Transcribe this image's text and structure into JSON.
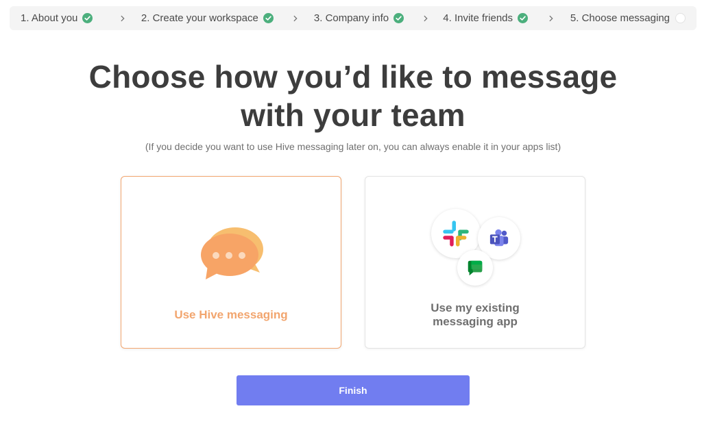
{
  "stepper": {
    "steps": [
      {
        "label": "1. About you",
        "status": "done"
      },
      {
        "label": "2. Create your workspace",
        "status": "done"
      },
      {
        "label": "3. Company info",
        "status": "done"
      },
      {
        "label": "4. Invite friends",
        "status": "done"
      },
      {
        "label": "5. Choose messaging",
        "status": "pending"
      }
    ]
  },
  "heading": {
    "line1": "Choose how you’d like to message",
    "line2": "with your team",
    "subtitle": "(If you decide you want to use Hive messaging later on, you can always enable it in your apps list)"
  },
  "options": {
    "hive": {
      "label": "Use Hive messaging",
      "icon": "chat-bubbles-icon",
      "selected": true
    },
    "existing": {
      "label_line1": "Use my existing",
      "label_line2": "messaging app",
      "icons": [
        "slack-icon",
        "teams-icon",
        "google-chat-icon"
      ],
      "selected": false
    }
  },
  "actions": {
    "finish_label": "Finish"
  },
  "colors": {
    "accent": "#f2a56e",
    "button": "#717df0",
    "check": "#4caf7d"
  }
}
